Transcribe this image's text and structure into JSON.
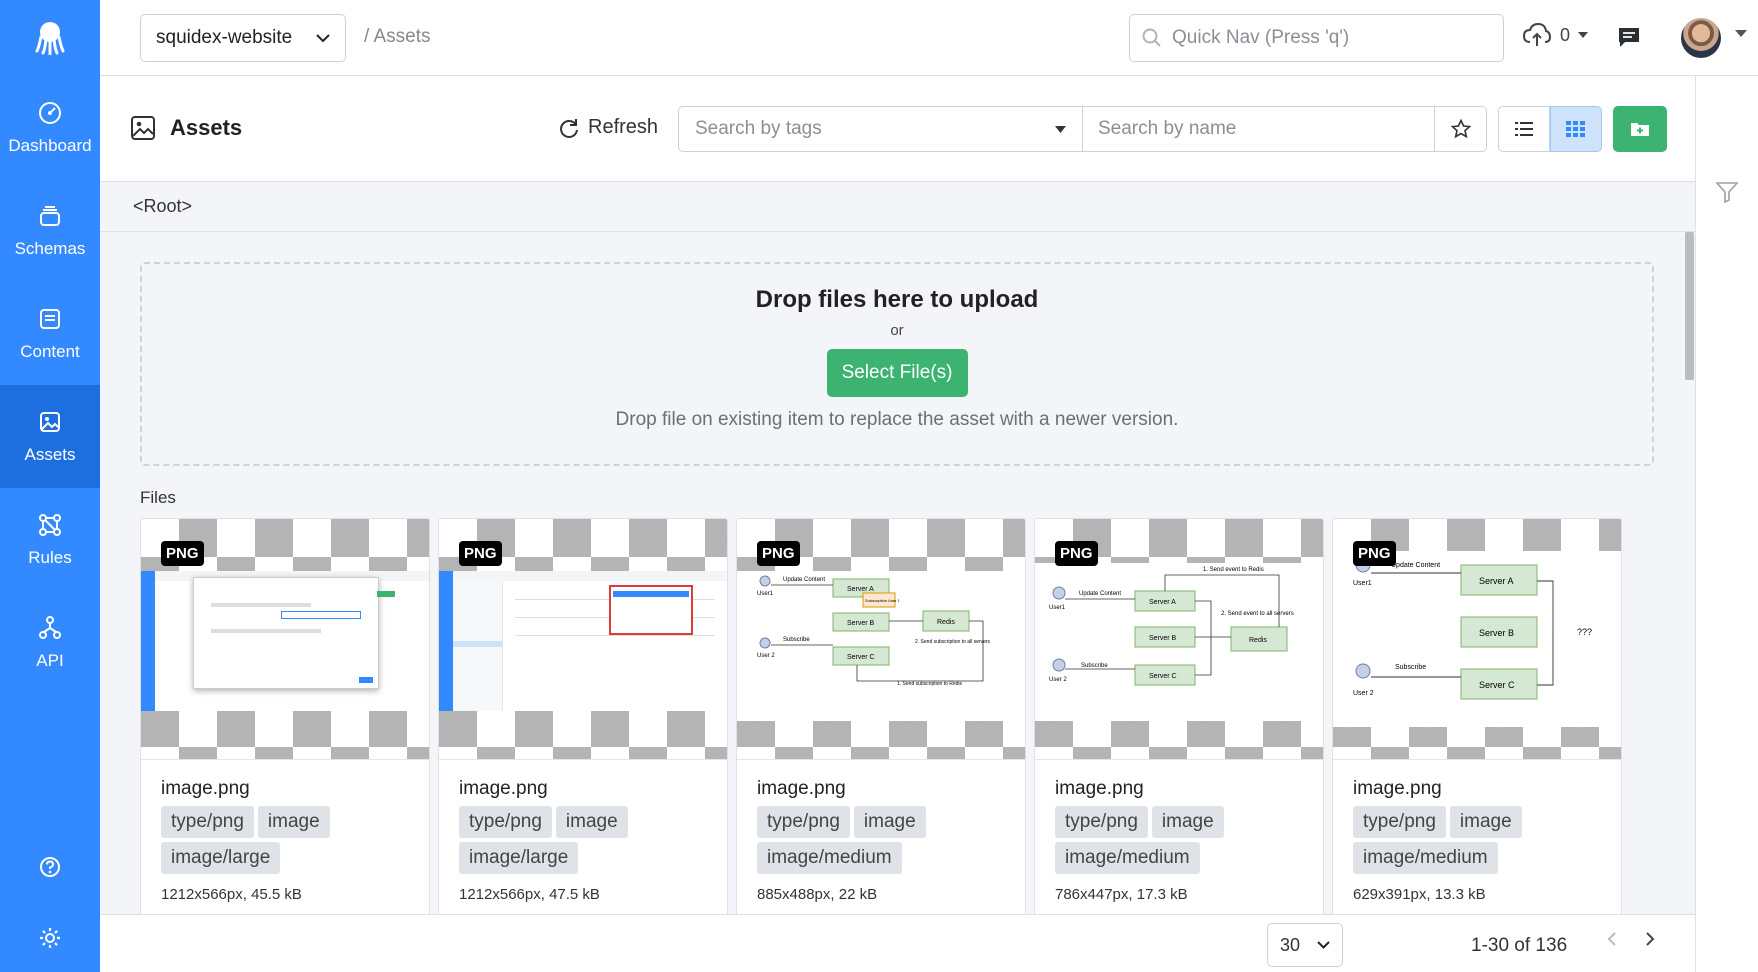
{
  "colors": {
    "sidebar": "#3389ff",
    "sidebar_active": "#1d6fe0",
    "primary_green": "#3cb371"
  },
  "sidebar": {
    "items": [
      {
        "label": "Dashboard",
        "icon": "dashboard-icon"
      },
      {
        "label": "Schemas",
        "icon": "schemas-icon"
      },
      {
        "label": "Content",
        "icon": "content-icon"
      },
      {
        "label": "Assets",
        "icon": "assets-icon",
        "active": true
      },
      {
        "label": "Rules",
        "icon": "rules-icon"
      },
      {
        "label": "API",
        "icon": "api-icon"
      }
    ]
  },
  "topbar": {
    "app_name": "squidex-website",
    "breadcrumb": "/  Assets",
    "quick_nav_placeholder": "Quick Nav (Press 'q')",
    "upload_count": "0"
  },
  "header": {
    "title": "Assets",
    "refresh_label": "Refresh",
    "tags_placeholder": "Search by tags",
    "name_placeholder": "Search by name"
  },
  "path": "<Root>",
  "dropzone": {
    "title": "Drop files here to upload",
    "or": "or",
    "button": "Select File(s)",
    "hint": "Drop file on existing item to replace the asset with a newer version."
  },
  "files_label": "Files",
  "assets": [
    {
      "badge": "PNG",
      "name": "image.png",
      "tags": [
        "type/png",
        "image",
        "image/large"
      ],
      "meta": "1212x566px, 45.5 kB"
    },
    {
      "badge": "PNG",
      "name": "image.png",
      "tags": [
        "type/png",
        "image",
        "image/large"
      ],
      "meta": "1212x566px, 47.5 kB"
    },
    {
      "badge": "PNG",
      "name": "image.png",
      "tags": [
        "type/png",
        "image",
        "image/medium"
      ],
      "meta": "885x488px, 22 kB"
    },
    {
      "badge": "PNG",
      "name": "image.png",
      "tags": [
        "type/png",
        "image",
        "image/medium"
      ],
      "meta": "786x447px, 17.3 kB"
    },
    {
      "badge": "PNG",
      "name": "image.png",
      "tags": [
        "type/png",
        "image",
        "image/medium"
      ],
      "meta": "629x391px, 13.3 kB"
    }
  ],
  "thumb_text": {
    "diagram_a": [
      "User1",
      "Update Content",
      "Server A",
      "Subscription User 1",
      "Server B",
      "Redis",
      "Subscribe",
      "User 2",
      "Server C",
      "2. Send subscription to all servers",
      "1. Send subscription to Redis"
    ],
    "diagram_b": [
      "1. Send event to Redis",
      "User1",
      "Update Content",
      "Server A",
      "2. Send event to all servers",
      "Server B",
      "Redis",
      "User 2",
      "Subscribe",
      "Server C"
    ],
    "diagram_c": [
      "User1",
      "Update Content",
      "Server A",
      "Server B",
      "???",
      "User 2",
      "Subscribe",
      "Server C"
    ]
  },
  "footer": {
    "page_size": "30",
    "range": "1-30 of 136"
  }
}
